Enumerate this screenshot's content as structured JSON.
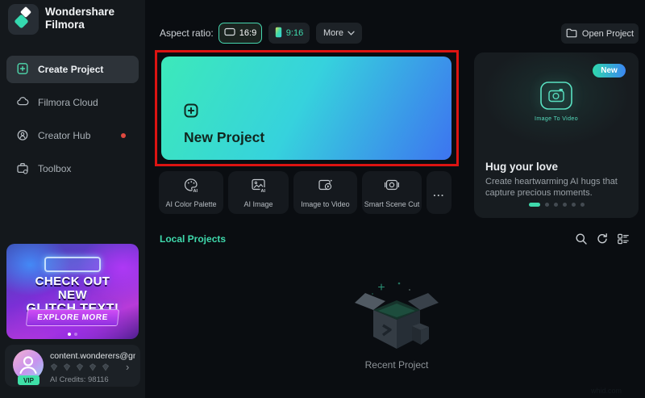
{
  "brand": {
    "line1": "Wondershare",
    "line2": "Filmora"
  },
  "sidebar": {
    "items": [
      {
        "label": "Create Project",
        "icon": "file-plus-icon",
        "active": true
      },
      {
        "label": "Filmora Cloud",
        "icon": "cloud-icon",
        "active": false
      },
      {
        "label": "Creator Hub",
        "icon": "creator-icon",
        "active": false,
        "notification_dot": true
      },
      {
        "label": "Toolbox",
        "icon": "toolbox-icon",
        "active": false
      }
    ],
    "promo": {
      "line1": "CHECK OUT",
      "line2": "NEW",
      "line3": "GLITCH TEXT!",
      "cta": "EXPLORE MORE",
      "dots_total": 2,
      "dots_active": 1
    },
    "account": {
      "email": "content.wonderers@gmail...",
      "vip_label": "VIP",
      "credits_label": "AI Credits:",
      "credits_value": "98116",
      "gem_count": 5
    }
  },
  "topbar": {
    "aspect_ratio_label": "Aspect ratio:",
    "ratios": [
      {
        "label": "16:9",
        "icon": "monitor-icon",
        "selected": true
      },
      {
        "label": "9:16",
        "icon": "phone-icon",
        "selected": false
      }
    ],
    "more_label": "More",
    "open_project_label": "Open Project"
  },
  "hero": {
    "new_project_label": "New Project"
  },
  "features": [
    {
      "label": "AI Color Palette",
      "icon": "palette-icon"
    },
    {
      "label": "AI Image",
      "icon": "ai-image-icon"
    },
    {
      "label": "Image to Video",
      "icon": "image-to-video-icon"
    },
    {
      "label": "Smart Scene Cut",
      "icon": "scene-cut-icon"
    }
  ],
  "features_more_label": "...",
  "promo_panel": {
    "badge": "New",
    "icon_caption": "Image To Video",
    "title": "Hug your love",
    "description": "Create heartwarming AI hugs that capture precious moments.",
    "dots_total": 6,
    "dots_active": 1
  },
  "local_projects": {
    "title": "Local Projects"
  },
  "empty_state": {
    "caption": "Recent Project"
  },
  "watermark": "whid.com",
  "colors": {
    "accent": "#3fd9ac",
    "annotation_red": "#dc1412",
    "sidebar_bg": "#14181c",
    "main_bg": "#0a0d11",
    "card_gradient": [
      "#3ce9ba",
      "#36d2dd",
      "#3d74f0"
    ],
    "badge_gradient": [
      "#2fd8ac",
      "#3b86f2"
    ],
    "vip_badge": "#3fe0a8"
  }
}
